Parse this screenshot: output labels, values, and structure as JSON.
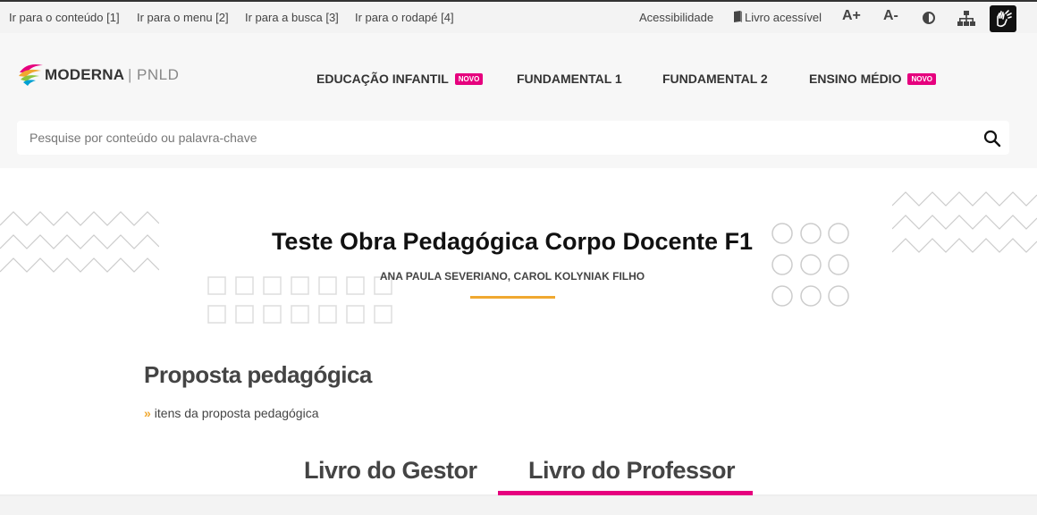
{
  "skip_links": [
    {
      "label": "Ir para o conteúdo [1]"
    },
    {
      "label": "Ir para o menu [2]"
    },
    {
      "label": "Ir para a busca [3]"
    },
    {
      "label": "Ir para o rodapé [4]"
    }
  ],
  "accessibility": {
    "label": "Acessibilidade",
    "accessible_book": "Livro acessível",
    "font_increase": "A+",
    "font_decrease": "A-",
    "contrast_icon": "contrast-icon",
    "sitemap_icon": "sitemap-icon",
    "libras_icon": "hands-sign-language-icon"
  },
  "brand": {
    "name": "MODERNA",
    "separator": "|",
    "program": "PNLD",
    "colors": [
      "#e6007e",
      "#f0a830",
      "#8bc53f",
      "#00a0d2"
    ]
  },
  "nav": [
    {
      "label": "EDUCAÇÃO INFANTIL",
      "badge": "NOVO"
    },
    {
      "label": "FUNDAMENTAL 1",
      "badge": ""
    },
    {
      "label": "FUNDAMENTAL 2",
      "badge": ""
    },
    {
      "label": "ENSINO MÉDIO",
      "badge": "NOVO"
    }
  ],
  "search": {
    "placeholder": "Pesquise por conteúdo ou palavra-chave",
    "value": "",
    "icon": "search-icon"
  },
  "work": {
    "title": "Teste Obra Pedagógica Corpo Docente F1",
    "authors": "ANA PAULA SEVERIANO, CAROL KOLYNIAK FILHO"
  },
  "proposta": {
    "title": "Proposta pedagógica",
    "link_arrow": "»",
    "link_label": "itens da proposta pedagógica"
  },
  "tabs": [
    {
      "label": "Livro do Gestor",
      "active": false
    },
    {
      "label": "Livro do Professor",
      "active": true
    }
  ],
  "colors": {
    "accent_pink": "#e6007e",
    "accent_orange": "#f0a830"
  }
}
